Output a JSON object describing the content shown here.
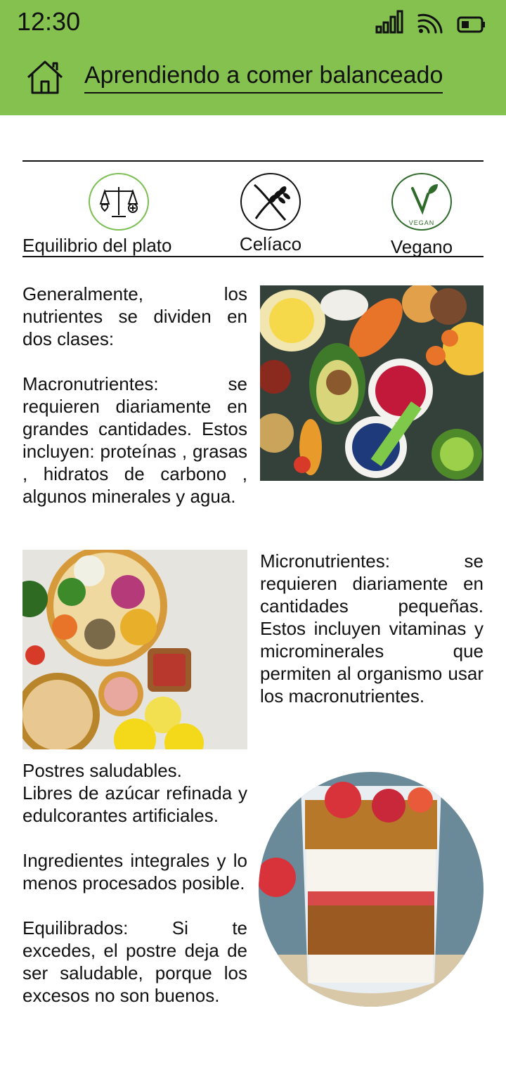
{
  "status_bar": {
    "time": "12:30"
  },
  "header": {
    "title": "Aprendiendo a comer balanceado"
  },
  "categories": [
    {
      "label": "Equilibrio del plato",
      "icon": "balance-scale-icon"
    },
    {
      "label": "Celíaco",
      "icon": "gluten-free-icon"
    },
    {
      "label": "Vegano",
      "icon": "vegan-icon",
      "badge_text": "VEGAN"
    }
  ],
  "section1": {
    "p1": "Generalmente, los nutrientes se dividen en dos clases:",
    "p2": "Macronutrientes: se requieren diariamente en grandes cantidades. Estos incluyen: proteínas , grasas , hidratos de carbono , algunos minerales y agua."
  },
  "section2": {
    "p1": "Micronutrientes: se requieren diariamente en cantidades pequeñas. Estos incluyen vitaminas y microminerales que permiten al organismo usar los macronutrientes."
  },
  "section3": {
    "p1": "Postres saludables.",
    "p2": "Libres de azúcar refinada y edulcorantes artificiales.",
    "p3": "Ingredientes integrales y lo menos procesados posible.",
    "p4": "Equilibrados: Si te excedes, el postre deja de ser saludable, porque los excesos no son buenos."
  },
  "colors": {
    "accent": "#84c14f",
    "icon_ring": "#7cbf52",
    "vegan_green": "#2e6b2a"
  }
}
